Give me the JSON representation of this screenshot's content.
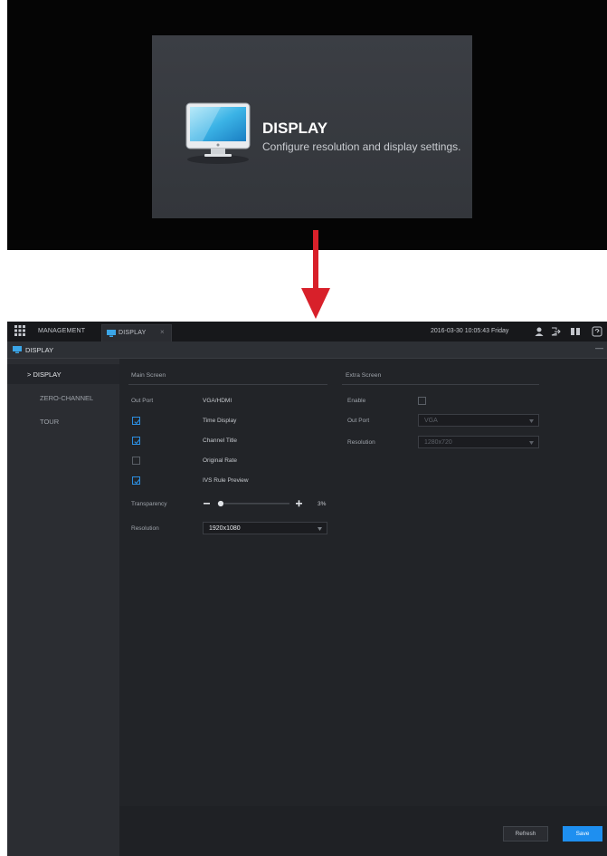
{
  "tile": {
    "title": "DISPLAY",
    "description": "Configure resolution and display settings."
  },
  "topbar": {
    "management_tab": "MANAGEMENT",
    "display_tab": "DISPLAY",
    "close": "×",
    "datetime": "2016-03-30 10:05:43 Friday"
  },
  "subbar": {
    "title": "DISPLAY",
    "minimize": "—"
  },
  "sidebar": {
    "items": [
      {
        "label": "> DISPLAY",
        "active": true
      },
      {
        "label": "ZERO-CHANNEL",
        "active": false
      },
      {
        "label": "TOUR",
        "active": false
      }
    ]
  },
  "main_screen": {
    "header": "Main Screen",
    "out_port_label": "Out Port",
    "out_port_value": "VGA/HDMI",
    "options": [
      {
        "label": "Time Display",
        "checked": true
      },
      {
        "label": "Channel Title",
        "checked": true
      },
      {
        "label": "Original Rate",
        "checked": false
      },
      {
        "label": "IVS Rule Preview",
        "checked": true
      }
    ],
    "transparency_label": "Transparency",
    "transparency_value": "3%",
    "transparency_level": 0.03,
    "resolution_label": "Resolution",
    "resolution_value": "1920x1080"
  },
  "extra_screen": {
    "header": "Extra Screen",
    "enable_label": "Enable",
    "enable_checked": false,
    "out_port_label": "Out Port",
    "out_port_value": "VGA",
    "resolution_label": "Resolution",
    "resolution_value": "1280x720"
  },
  "footer": {
    "refresh_label": "Refresh",
    "save_label": "Save"
  },
  "colors": {
    "accent": "#1e8ff0",
    "arrow": "#d8202a",
    "background": "#25272b"
  }
}
